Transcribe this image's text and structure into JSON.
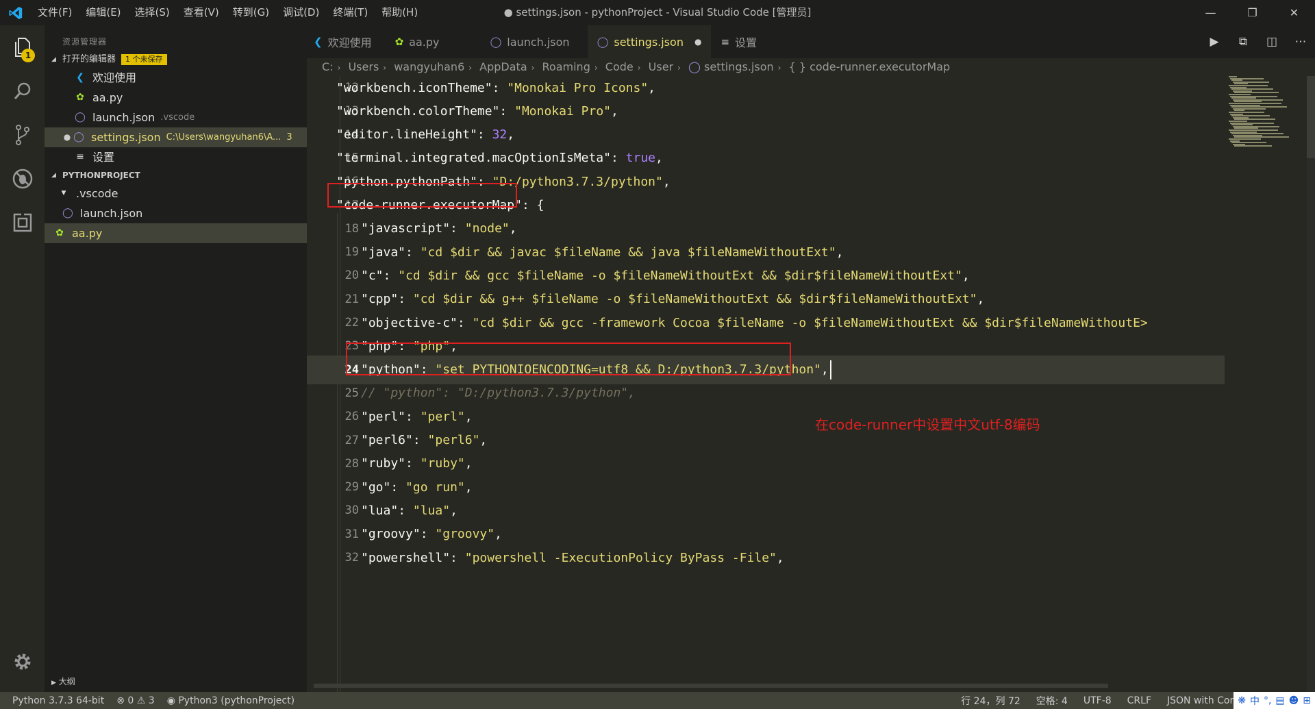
{
  "window": {
    "title": "● settings.json - pythonProject - Visual Studio Code [管理员]",
    "menu": [
      "文件(F)",
      "编辑(E)",
      "选择(S)",
      "查看(V)",
      "转到(G)",
      "调试(D)",
      "终端(T)",
      "帮助(H)"
    ]
  },
  "activity": {
    "explorer_badge": "1"
  },
  "sidebar": {
    "title": "资源管理器",
    "open_editors_label": "打开的编辑器",
    "unsaved_badge": "1 个未保存",
    "open_editors": [
      {
        "name": "欢迎使用",
        "hint": ""
      },
      {
        "name": "aa.py",
        "hint": ""
      },
      {
        "name": "launch.json",
        "hint": ".vscode"
      },
      {
        "name": "settings.json",
        "hint": "C:\\Users\\wangyuhan6\\A...",
        "count": "3"
      },
      {
        "name": "设置",
        "hint": ""
      }
    ],
    "project_label": "PYTHONPROJECT",
    "folder": ".vscode",
    "files": [
      "launch.json",
      "aa.py"
    ],
    "outline_label": "大纲"
  },
  "tabs": [
    {
      "label": "欢迎使用"
    },
    {
      "label": "aa.py"
    },
    {
      "label": "launch.json"
    },
    {
      "label": "settings.json"
    },
    {
      "label": "设置"
    }
  ],
  "breadcrumb": [
    "C:",
    "Users",
    "wangyuhan6",
    "AppData",
    "Roaming",
    "Code",
    "User",
    "settings.json",
    "{ } code-runner.executorMap"
  ],
  "editor": {
    "lines": [
      {
        "n": "12",
        "key": "\"workbench.iconTheme\"",
        "val": "\"Monokai Pro Icons\"",
        "end": ","
      },
      {
        "n": "13",
        "key": "\"workbench.colorTheme\"",
        "val": "\"Monokai Pro\"",
        "end": ","
      },
      {
        "n": "14",
        "key": "\"editor.lineHeight\"",
        "val": "32",
        "end": ","
      },
      {
        "n": "15",
        "key": "\"terminal.integrated.macOptionIsMeta\"",
        "val": "true",
        "end": ","
      },
      {
        "n": "16",
        "key": "\"python.pythonPath\"",
        "val": "\"D:/python3.7.3/python\"",
        "end": ","
      },
      {
        "n": "17",
        "key": "\"code-runner.executorMap\"",
        "val": "{",
        "end": ""
      },
      {
        "n": "18",
        "key": "\"javascript\"",
        "val": "\"node\"",
        "end": ","
      },
      {
        "n": "19",
        "key": "\"java\"",
        "val": "\"cd $dir && javac $fileName && java $fileNameWithoutExt\"",
        "end": ","
      },
      {
        "n": "20",
        "key": "\"c\"",
        "val": "\"cd $dir && gcc $fileName -o $fileNameWithoutExt && $dir$fileNameWithoutExt\"",
        "end": ","
      },
      {
        "n": "21",
        "key": "\"cpp\"",
        "val": "\"cd $dir && g++ $fileName -o $fileNameWithoutExt && $dir$fileNameWithoutExt\"",
        "end": ","
      },
      {
        "n": "22",
        "key": "\"objective-c\"",
        "val": "\"cd $dir && gcc -framework Cocoa $fileName -o $fileNameWithoutExt && $dir$fileNameWithoutE>",
        "end": ""
      },
      {
        "n": "23",
        "key": "\"php\"",
        "val": "\"php\"",
        "end": ","
      },
      {
        "n": "24",
        "key": "\"python\"",
        "val": "\"set PYTHONIOENCODING=utf8 && D:/python3.7.3/python\"",
        "end": ","
      },
      {
        "n": "25",
        "comment": "// \"python\": \"D:/python3.7.3/python\","
      },
      {
        "n": "26",
        "key": "\"perl\"",
        "val": "\"perl\"",
        "end": ","
      },
      {
        "n": "27",
        "key": "\"perl6\"",
        "val": "\"perl6\"",
        "end": ","
      },
      {
        "n": "28",
        "key": "\"ruby\"",
        "val": "\"ruby\"",
        "end": ","
      },
      {
        "n": "29",
        "key": "\"go\"",
        "val": "\"go run\"",
        "end": ","
      },
      {
        "n": "30",
        "key": "\"lua\"",
        "val": "\"lua\"",
        "end": ","
      },
      {
        "n": "31",
        "key": "\"groovy\"",
        "val": "\"groovy\"",
        "end": ","
      },
      {
        "n": "32",
        "key": "\"powershell\"",
        "val": "\"powershell -ExecutionPolicy ByPass -File\"",
        "end": ","
      }
    ],
    "annotation": "在code-runner中设置中文utf-8编码"
  },
  "status": {
    "interpreter": "Python 3.7.3 64-bit",
    "errors": "0",
    "warnings": "3",
    "kernel": "Python3 (pythonProject)",
    "position": "行 24，列 72",
    "spaces": "空格: 4",
    "encoding": "UTF-8",
    "eol": "CRLF",
    "language": "JSON with Cor",
    "ime": "中"
  }
}
